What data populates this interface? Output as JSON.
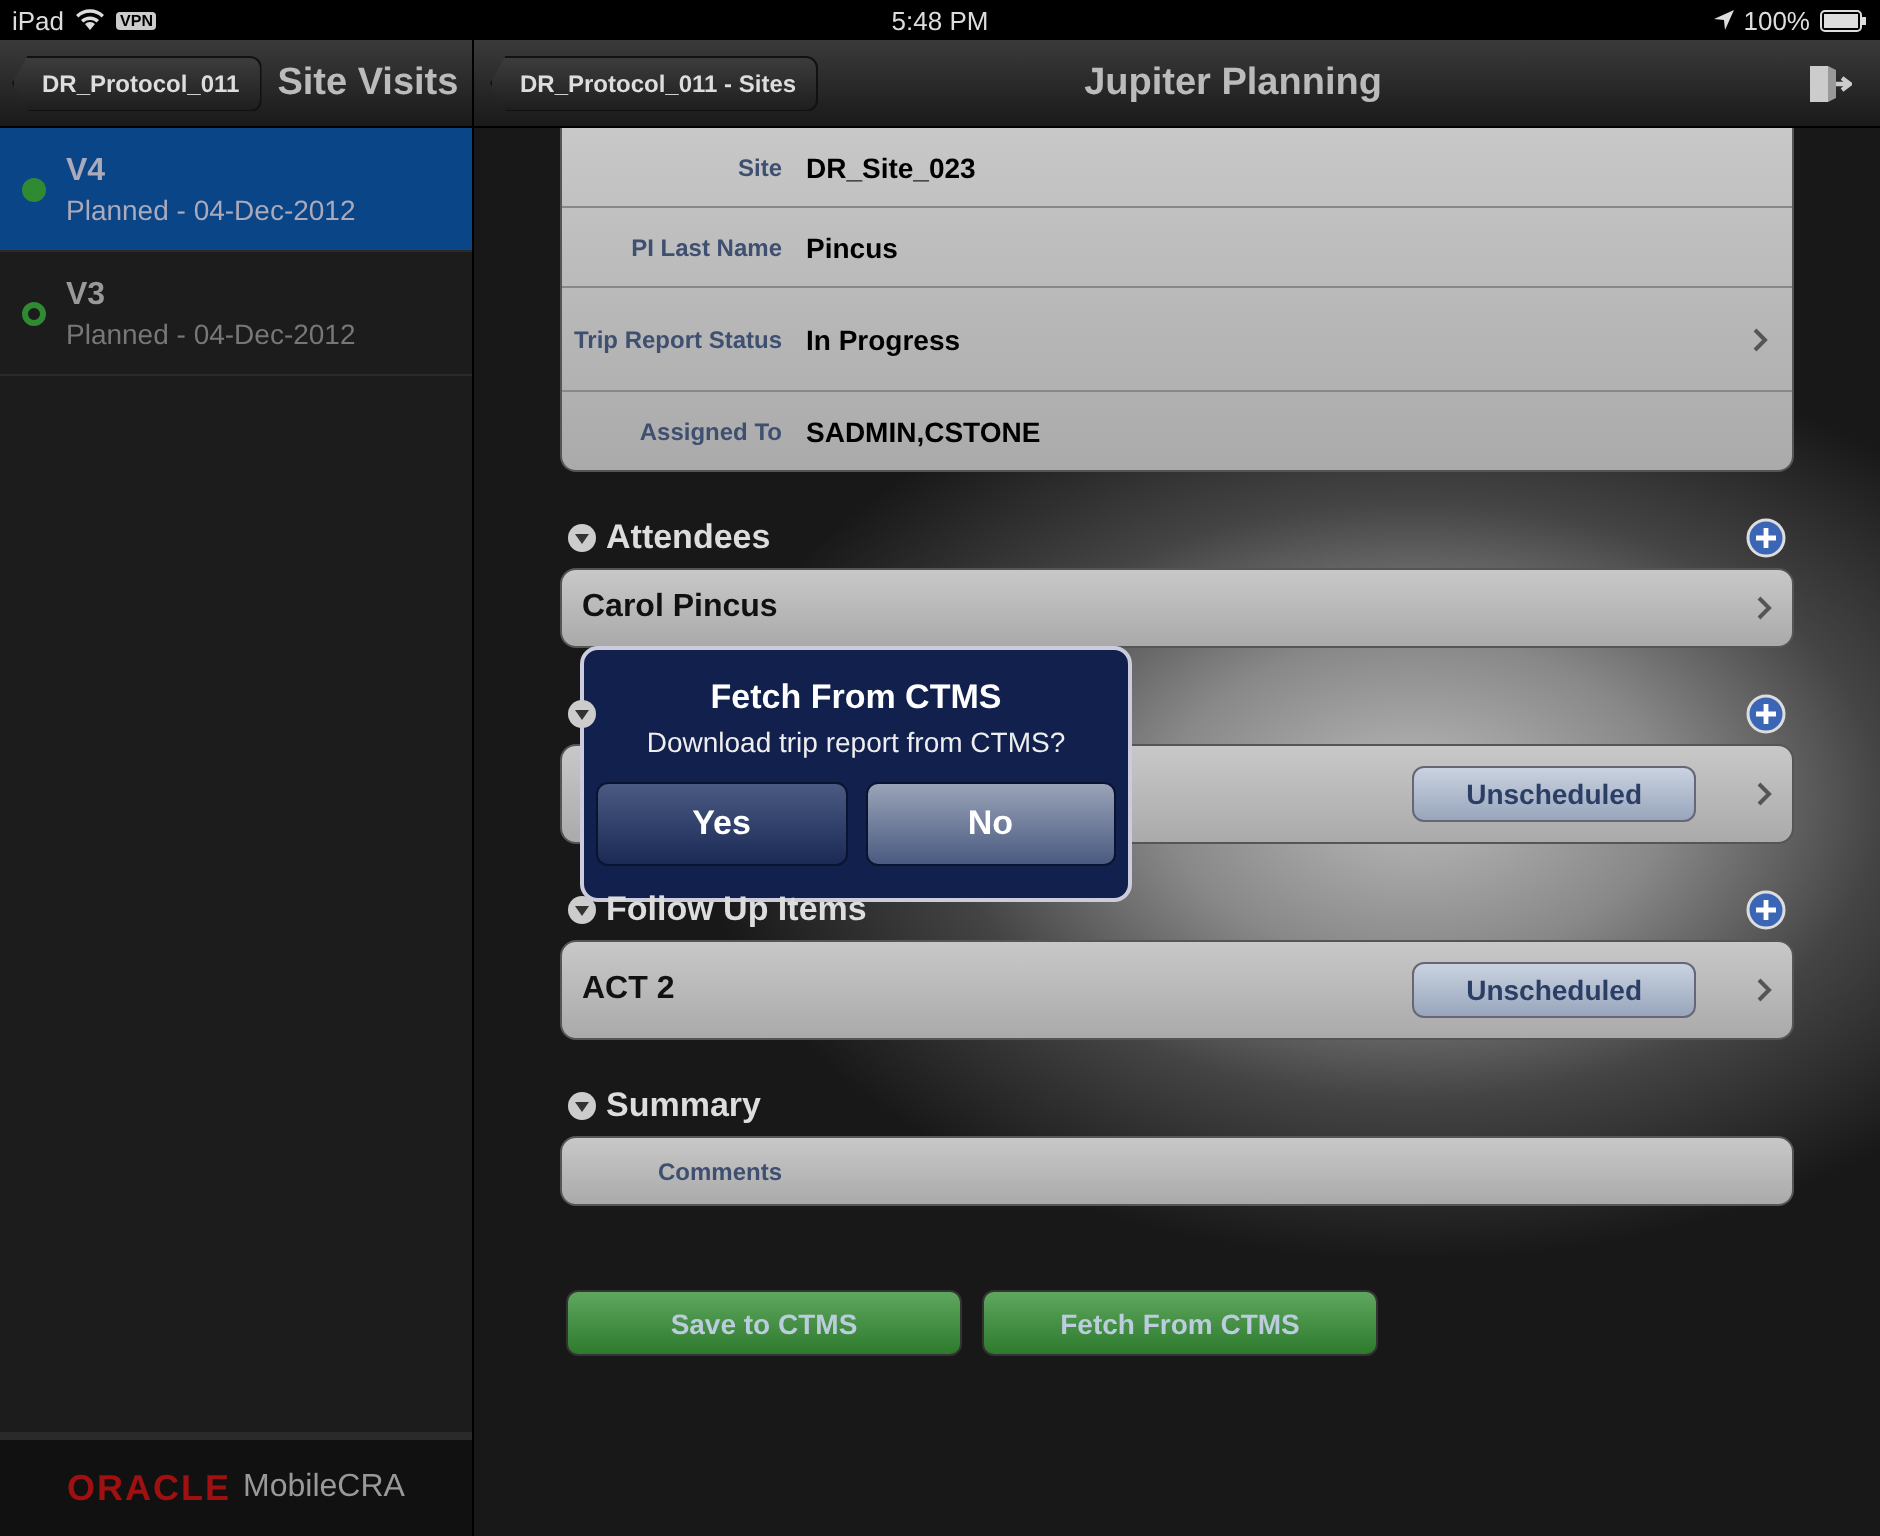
{
  "status_bar": {
    "device": "iPad",
    "vpn": "VPN",
    "time": "5:48 PM",
    "battery": "100%"
  },
  "left_nav": {
    "back": "DR_Protocol_011",
    "title": "Site Visits"
  },
  "visits": [
    {
      "title": "V4",
      "subtitle": "Planned - 04-Dec-2012",
      "selected": true,
      "kind": "filled"
    },
    {
      "title": "V3",
      "subtitle": "Planned - 04-Dec-2012",
      "selected": false,
      "kind": "outline"
    }
  ],
  "footer": {
    "brand": "ORACLE",
    "product": "MobileCRA"
  },
  "detail_nav": {
    "back": "DR_Protocol_011 - Sites",
    "title": "Jupiter Planning"
  },
  "fields": [
    {
      "label": "Site",
      "value": "DR_Site_023",
      "disclosure": false
    },
    {
      "label": "PI Last Name",
      "value": "Pincus",
      "disclosure": false
    },
    {
      "label": "Trip Report Status",
      "value": "In Progress",
      "disclosure": true
    },
    {
      "label": "Assigned To",
      "value": "SADMIN,CSTONE",
      "disclosure": false
    }
  ],
  "sections": [
    {
      "title": "Attendees",
      "add": true,
      "kind": "list",
      "items": [
        {
          "name": "Carol Pincus",
          "disclosure": true
        }
      ]
    },
    {
      "add": true,
      "kind": "list",
      "items": [
        {
          "badge": "Unscheduled",
          "disclosure": true
        }
      ]
    },
    {
      "title": "Follow Up Items",
      "add": true,
      "kind": "list",
      "items": [
        {
          "name": "ACT 2",
          "badge": "Unscheduled",
          "disclosure": true
        }
      ]
    },
    {
      "title": "Summary",
      "add": false,
      "kind": "form",
      "items": [
        {
          "name": "Comments"
        }
      ]
    }
  ],
  "actions": [
    "Save to CTMS",
    "Fetch From CTMS"
  ],
  "dialog": {
    "title": "Fetch From CTMS",
    "message": "Download trip report from CTMS?",
    "buttons": [
      "Yes",
      "No"
    ]
  }
}
